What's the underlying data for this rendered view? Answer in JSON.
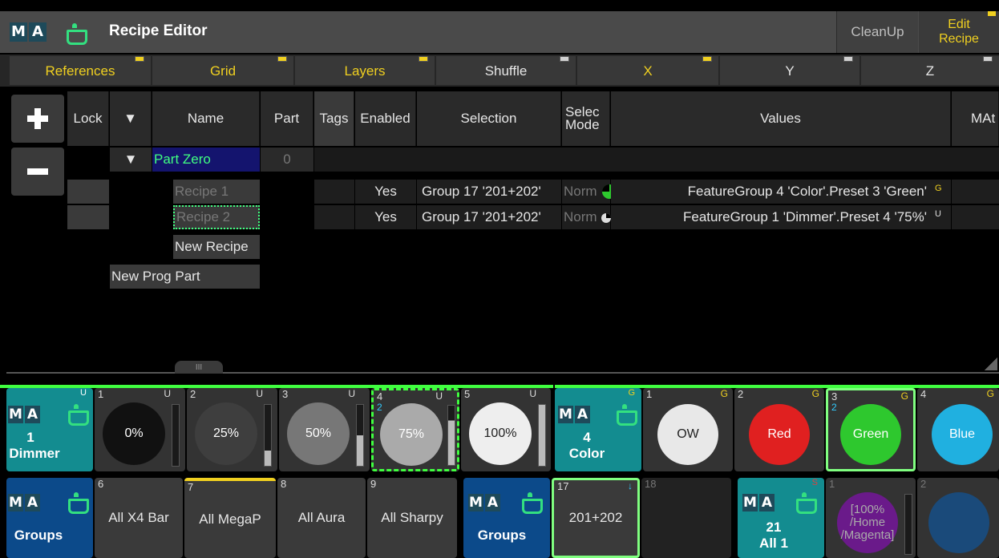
{
  "title_bar": {
    "title": "Recipe Editor",
    "cleanup_label": "CleanUp",
    "edit_recipe_label_1": "Edit",
    "edit_recipe_label_2": "Recipe"
  },
  "ref_tabs": [
    {
      "label": "References",
      "color": "#f0d020"
    },
    {
      "label": "Grid",
      "color": "#f0d020"
    },
    {
      "label": "Layers",
      "color": "#f0d020"
    },
    {
      "label": "Shuffle",
      "color": "#e6e6e6"
    },
    {
      "label": "X",
      "color": "#f0d020"
    },
    {
      "label": "Y",
      "color": "#e6e6e6"
    },
    {
      "label": "Z",
      "color": "#e6e6e6"
    }
  ],
  "columns": {
    "lock": "Lock",
    "filter": "▼",
    "name": "Name",
    "part": "Part",
    "tags": "Tags",
    "enabled": "Enabled",
    "selection": "Selection",
    "select_mode_1": "Selec",
    "select_mode_2": "Mode",
    "values": "Values",
    "mat": "MAt"
  },
  "rows": {
    "part_zero_name": "Part Zero",
    "part_zero_part": "0",
    "part_zero_arrow": "▼",
    "recipe1": {
      "name": "Recipe 1",
      "enabled": "Yes",
      "selection": "Group 17 '201+202'",
      "mode": "Norm",
      "value": "FeatureGroup 4 'Color'.Preset 3 'Green'",
      "flag": "G"
    },
    "recipe2": {
      "name": "Recipe 2",
      "enabled": "Yes",
      "selection": "Group 17 '201+202'",
      "mode": "Norm",
      "value": "FeatureGroup 1 'Dimmer'.Preset 4 '75%'",
      "flag": "U"
    },
    "new_recipe": "New Recipe",
    "new_prog_part": "New Prog Part"
  },
  "dimmer_pool": {
    "head_number": "1",
    "head_label": "Dimmer",
    "head_flag": "U",
    "items": [
      {
        "num": "1",
        "flag": "U",
        "label": "0%"
      },
      {
        "num": "2",
        "flag": "U",
        "label": "25%"
      },
      {
        "num": "3",
        "flag": "U",
        "label": "50%"
      },
      {
        "num": "4",
        "flag": "U",
        "label": "75%",
        "sub": "2"
      },
      {
        "num": "5",
        "flag": "U",
        "label": "100%"
      }
    ]
  },
  "color_pool": {
    "head_number": "4",
    "head_label": "Color",
    "head_flag": "G",
    "items": [
      {
        "num": "1",
        "flag": "G",
        "label": "OW",
        "color": "#e8e8e8"
      },
      {
        "num": "2",
        "flag": "G",
        "label": "Red",
        "color": "#e02020"
      },
      {
        "num": "3",
        "flag": "G",
        "label": "Green",
        "color": "#2ec82e",
        "sub": "2"
      },
      {
        "num": "4",
        "flag": "G",
        "label": "Blue",
        "color": "#20b0e0"
      }
    ]
  },
  "groups_pool_1": {
    "head_label": "Groups",
    "items": [
      {
        "num": "6",
        "label": "All X4 Bar"
      },
      {
        "num": "7",
        "label": "All MegaP"
      },
      {
        "num": "8",
        "label": "All Aura"
      },
      {
        "num": "9",
        "label": "All Sharpy"
      }
    ]
  },
  "groups_pool_2": {
    "head_label": "Groups",
    "items": [
      {
        "num": "17",
        "label": "201+202"
      },
      {
        "num": "18",
        "label": ""
      }
    ]
  },
  "all_pool": {
    "head_number": "21",
    "head_label": "All 1",
    "head_flag": "S",
    "items": [
      {
        "num": "1",
        "label_1": "[100%",
        "label_2": "/Home",
        "label_3": "/Magenta]"
      },
      {
        "num": "2",
        "label_1": "",
        "label_2": "",
        "label_3": ""
      }
    ]
  }
}
